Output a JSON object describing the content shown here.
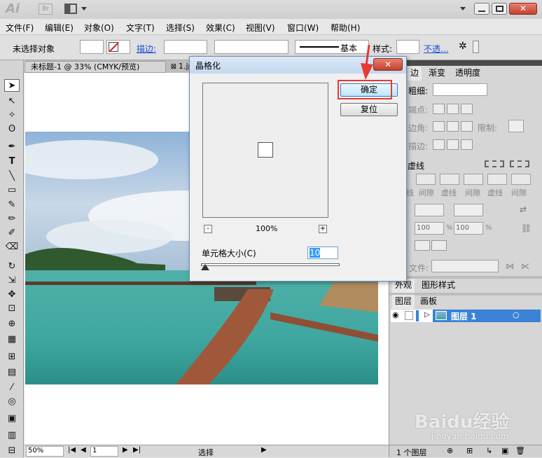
{
  "app": {
    "logo": "Ai",
    "bridge": "Br"
  },
  "menu": [
    "文件(F)",
    "编辑(E)",
    "对象(O)",
    "文字(T)",
    "选择(S)",
    "效果(C)",
    "视图(V)",
    "窗口(W)",
    "帮助(H)"
  ],
  "control": {
    "selection": "未选择对象",
    "stroke_label": "描边:",
    "stroke_style": "基本",
    "style_label": "样式:",
    "opacity_label": "不透..."
  },
  "doc_tabs": [
    "未标题-1 @ 33% (CMYK/预览)",
    "1.jp"
  ],
  "status": {
    "zoom": "50%",
    "page": "1",
    "mode": "选择"
  },
  "right_panel": {
    "tabs_top": [
      "边",
      "渐变",
      "透明度"
    ],
    "weight_label": "粗细:",
    "cap_label": "端点:",
    "corner_label": "边角:",
    "limit_label": "限制:",
    "align_label": "描边:",
    "dashed_label": "虚线",
    "dash_labels": [
      "线",
      "间隙",
      "虚线",
      "间隙",
      "虚线",
      "间隙"
    ],
    "scale_a": "100",
    "scale_b": "100",
    "pct": "%",
    "file_label": "文件:",
    "appearance_tabs": [
      "外观",
      "图形样式"
    ],
    "layer_tabs": [
      "图层",
      "画板"
    ],
    "layer_name": "图层 1",
    "layer_count": "1 个图层"
  },
  "dialog": {
    "title": "晶格化",
    "ok": "确定",
    "reset": "复位",
    "zoom_pct": "100%",
    "minus": "-",
    "plus": "+",
    "cell_label": "单元格大小(C)",
    "cell_value": "10",
    "close": "✕"
  },
  "watermark": {
    "brand": "Baidu经验",
    "url": "jingyan.baidu.com"
  },
  "colors": {
    "highlight": "#e53935",
    "layer_select": "#3b83d6"
  }
}
